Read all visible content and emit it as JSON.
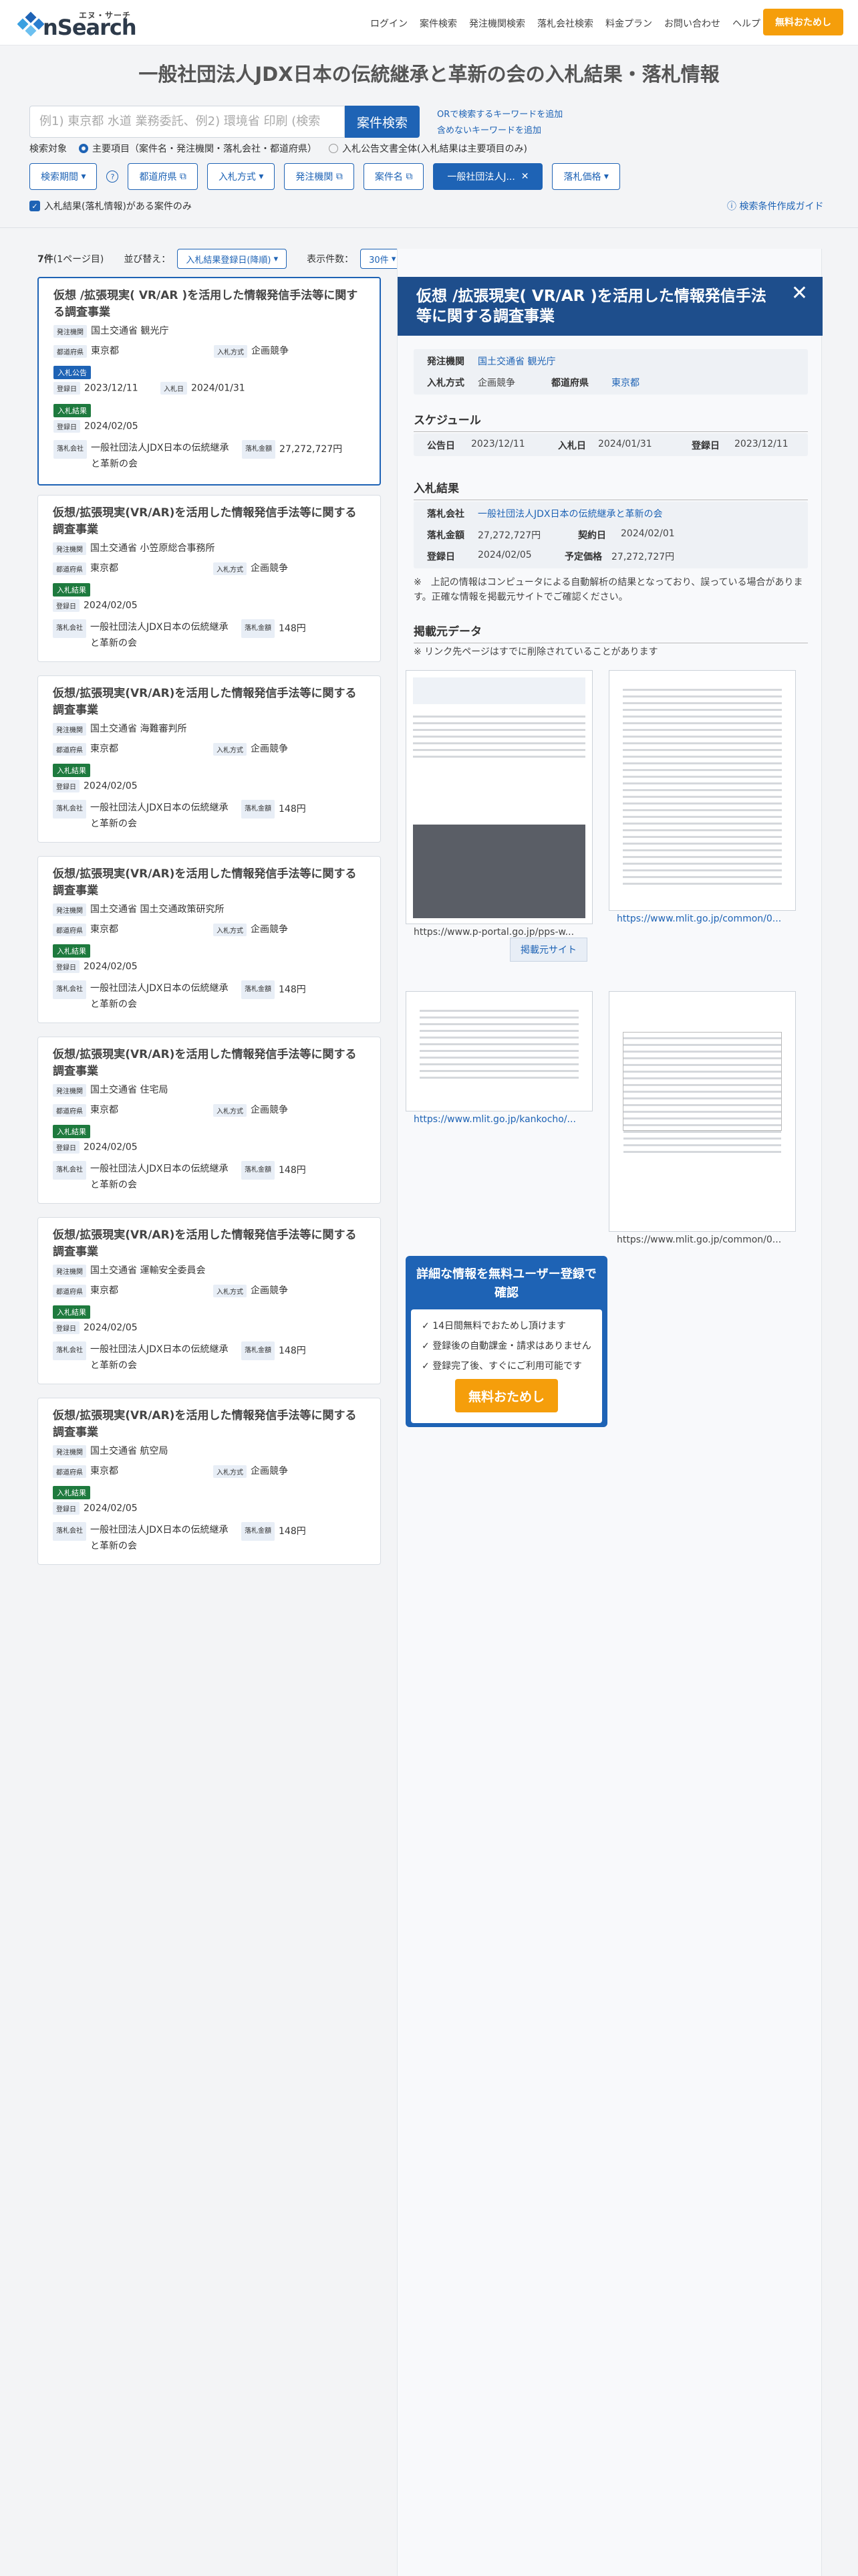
{
  "header": {
    "logo_sub": "エヌ・サーチ",
    "logo": "nSearch",
    "nav": [
      "ログイン",
      "案件検索",
      "発注機関検索",
      "落札会社検索",
      "料金プラン",
      "お問い合わせ",
      "ヘルプ"
    ],
    "trial": "無料おためし"
  },
  "page_title": "一般社団法人JDX日本の伝統継承と革新の会の入札結果・落札情報",
  "search": {
    "placeholder": "例1) 東京都 水道 業務委託、例2) 環境省 印刷 (検索",
    "button": "案件検索",
    "or_link": "ORで検索するキーワードを追加",
    "exclude_link": "含めないキーワードを追加"
  },
  "target": {
    "label": "検索対象",
    "opt1": "主要項目（案件名・発注機関・落札会社・都道府県）",
    "opt2": "入札公告文書全体(入札結果は主要項目のみ)"
  },
  "filters": [
    "検索期間",
    "都道府県",
    "入札方式",
    "発注機関",
    "案件名",
    "一般社団法人J...",
    "落札価格"
  ],
  "checkbox": "入札結果(落札情報)がある案件のみ",
  "guide": "検索条件作成ガイド",
  "results": {
    "count": "7件",
    "page": "(1ページ目)",
    "sort_label": "並び替え：",
    "sort": "入札結果登録日(降順)",
    "per_label": "表示件数：",
    "per": "30件"
  },
  "labels": {
    "agency": "発注機関",
    "pref": "都道府県",
    "method": "入札方式",
    "notice": "入札公告",
    "result": "入札結果",
    "reg": "登録日",
    "bid": "入札日",
    "winner": "落札会社",
    "amount": "落札金額"
  },
  "cards": [
    {
      "title": "仮想 /拡張現実( VR/AR )を活用した情報発信手法等に関する調査事業",
      "agency": "国土交通省 観光庁",
      "pref": "東京都",
      "method": "企画競争",
      "notice_reg": "2023/12/11",
      "bid_date": "2024/01/31",
      "result_reg": "2024/02/05",
      "winner": "一般社団法人JDX日本の伝統継承と革新の会",
      "amount": "27,272,727円"
    },
    {
      "title": "仮想/拡張現実(VR/AR)を活用した情報発信手法等に関する調査事業",
      "agency": "国土交通省 小笠原総合事務所",
      "pref": "東京都",
      "method": "企画競争",
      "result_reg": "2024/02/05",
      "winner": "一般社団法人JDX日本の伝統継承と革新の会",
      "amount": "148円"
    },
    {
      "title": "仮想/拡張現実(VR/AR)を活用した情報発信手法等に関する調査事業",
      "agency": "国土交通省 海難審判所",
      "pref": "東京都",
      "method": "企画競争",
      "result_reg": "2024/02/05",
      "winner": "一般社団法人JDX日本の伝統継承と革新の会",
      "amount": "148円"
    },
    {
      "title": "仮想/拡張現実(VR/AR)を活用した情報発信手法等に関する調査事業",
      "agency": "国土交通省 国土交通政策研究所",
      "pref": "東京都",
      "method": "企画競争",
      "result_reg": "2024/02/05",
      "winner": "一般社団法人JDX日本の伝統継承と革新の会",
      "amount": "148円"
    },
    {
      "title": "仮想/拡張現実(VR/AR)を活用した情報発信手法等に関する調査事業",
      "agency": "国土交通省 住宅局",
      "pref": "東京都",
      "method": "企画競争",
      "result_reg": "2024/02/05",
      "winner": "一般社団法人JDX日本の伝統継承と革新の会",
      "amount": "148円"
    },
    {
      "title": "仮想/拡張現実(VR/AR)を活用した情報発信手法等に関する調査事業",
      "agency": "国土交通省 運輸安全委員会",
      "pref": "東京都",
      "method": "企画競争",
      "result_reg": "2024/02/05",
      "winner": "一般社団法人JDX日本の伝統継承と革新の会",
      "amount": "148円"
    },
    {
      "title": "仮想/拡張現実(VR/AR)を活用した情報発信手法等に関する調査事業",
      "agency": "国土交通省 航空局",
      "pref": "東京都",
      "method": "企画競争",
      "result_reg": "2024/02/05",
      "winner": "一般社団法人JDX日本の伝統継承と革新の会",
      "amount": "148円"
    }
  ],
  "detail": {
    "title": "仮想 /拡張現実( VR/AR )を活用した情報発信手法等に関する調査事業",
    "agency_k": "発注機関",
    "agency": "国土交通省 観光庁",
    "method_k": "入札方式",
    "method": "企画競争",
    "pref_k": "都道府県",
    "pref": "東京都",
    "schedule_title": "スケジュール",
    "notice_k": "公告日",
    "notice": "2023/12/11",
    "bid_k": "入札日",
    "bid": "2024/01/31",
    "reg_k": "登録日",
    "reg": "2023/12/11",
    "result_title": "入札結果",
    "winner_k": "落札会社",
    "winner": "一般社団法人JDX日本の伝統継承と革新の会",
    "amount_k": "落札金額",
    "amount": "27,272,727円",
    "contract_k": "契約日",
    "contract": "2024/02/01",
    "reg2_k": "登録日",
    "reg2": "2024/02/05",
    "planned_k": "予定価格",
    "planned": "27,272,727円",
    "note": "※　上記の情報はコンピュータによる自動解析の結果となっており、誤っている場合があります。正確な情報を掲載元サイトでご確認ください。",
    "source_title": "掲載元データ",
    "source_note": "※ リンク先ページはすでに削除されていることがあります",
    "thumb1": "https://www.p-portal.go.jp/pps-w...",
    "thumb2": "https://www.mlit.go.jp/common/0...",
    "thumb3": "https://www.mlit.go.jp/kankocho/...",
    "thumb4": "https://www.mlit.go.jp/common/0...",
    "source_btn": "掲載元サイト"
  },
  "cta": {
    "title": "詳細な情報を無料ユーザー登録で確認",
    "items": [
      "14日間無料でおためし頂けます",
      "登録後の自動課金・請求はありません",
      "登録完了後、すぐにご利用可能です"
    ],
    "button": "無料おためし"
  }
}
